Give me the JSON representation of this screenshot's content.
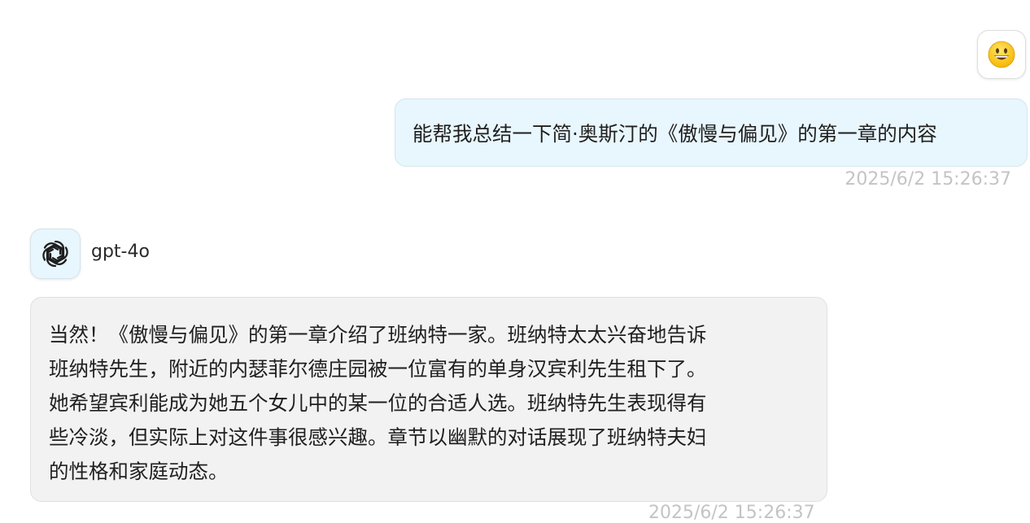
{
  "user": {
    "avatar_icon": "grinning-face-emoji",
    "message": "能帮我总结一下简·奥斯汀的《傲慢与偏见》的第一章的内容",
    "timestamp": "2025/6/2 15:26:37"
  },
  "assistant": {
    "avatar_icon": "openai-logo-icon",
    "model": "gpt-4o",
    "message_lines": [
      "当然！《傲慢与偏见》的第一章介绍了班纳特一家。班纳特太太兴奋地告诉",
      "班纳特先生，附近的内瑟菲尔德庄园被一位富有的单身汉宾利先生租下了。",
      "她希望宾利能成为她五个女儿中的某一位的合适人选。班纳特先生表现得有",
      "些冷淡，但实际上对这件事很感兴趣。章节以幽默的对话展现了班纳特夫妇",
      "的性格和家庭动态。"
    ],
    "timestamp": "2025/6/2 15:26:37"
  }
}
